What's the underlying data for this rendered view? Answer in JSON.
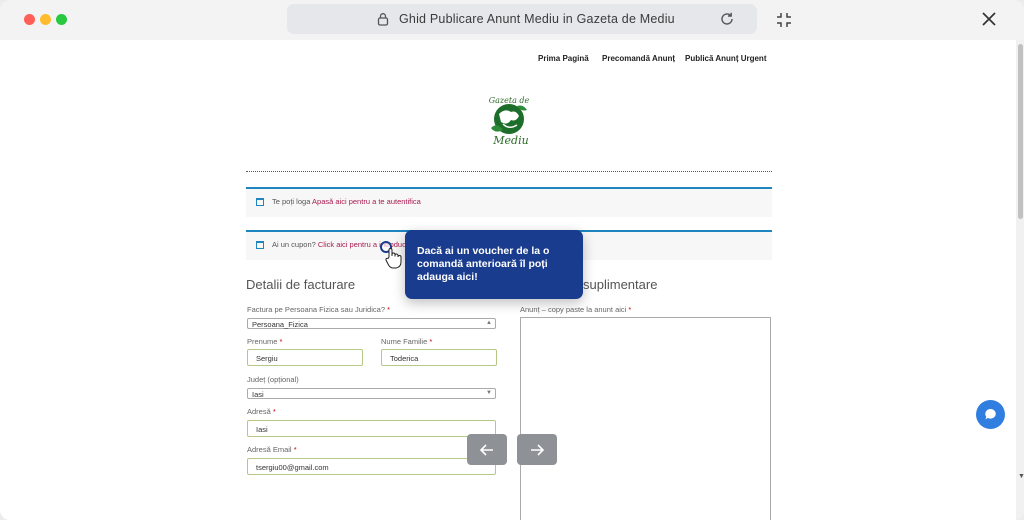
{
  "window": {
    "url_title": "Ghid Publicare Anunt Mediu in Gazeta de Mediu"
  },
  "nav": {
    "items": [
      "Prima Pagină",
      "Precomandă Anunț",
      "Publică Anunț Urgent"
    ]
  },
  "logo": {
    "text_top": "Gazeta de",
    "text_bottom": "Mediu"
  },
  "notices": {
    "login_text": "Te poți loga ",
    "login_link": "Apasă aici pentru a te autentifica",
    "coupon_text": "Ai un cupon? ",
    "coupon_link": "Click aici pentru a introduce"
  },
  "billing": {
    "heading": "Detalii de facturare",
    "person_type_label": "Factura pe Persoana Fizica sau Juridica?",
    "person_type_value": "Persoana_Fizica",
    "first_name_label": "Prenume",
    "first_name_value": "Sergiu",
    "last_name_label": "Nume Familie",
    "last_name_value": "Toderica",
    "county_label": "Județ (opțional)",
    "county_value": "Iasi",
    "address_label": "Adresă",
    "address_value": "Iasi",
    "email_label": "Adresă Email",
    "email_value": "tsergiu00@gmail.com",
    "required_mark": "*"
  },
  "extra": {
    "heading": "suplimentare",
    "ad_label": "Anunț – copy paste la anunt aici"
  },
  "tooltip": {
    "text": "Dacă ai un voucher de la o comandă anterioară îl poți adauga aici!"
  },
  "colors": {
    "tooltip_bg": "#1a3c8e",
    "link": "#a81a4e",
    "notice_border": "#1e85be",
    "chat": "#2f7ee0"
  }
}
